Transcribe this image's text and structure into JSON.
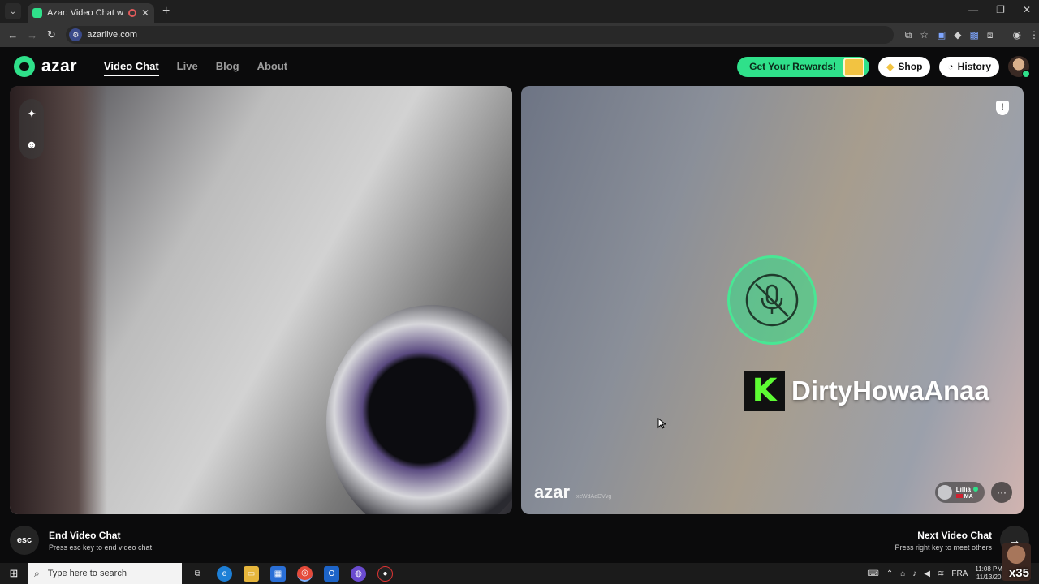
{
  "browser": {
    "tab_title": "Azar: Video Chat with New",
    "new_tab": "+",
    "url": "azarlive.com",
    "window_controls": [
      "—",
      "❐",
      "✕"
    ]
  },
  "header": {
    "logo": "azar",
    "nav": [
      {
        "label": "Video Chat",
        "active": true
      },
      {
        "label": "Live",
        "active": false
      },
      {
        "label": "Blog",
        "active": false
      },
      {
        "label": "About",
        "active": false
      }
    ],
    "rewards_label": "Get Your Rewards!",
    "shop_label": "Shop",
    "history_label": "History"
  },
  "local_video": {
    "tools": [
      "sparkle-icon",
      "sticker-icon"
    ]
  },
  "remote_video": {
    "overlay_name": "DirtyHowaAnaa",
    "overlay_logo_letter": "K",
    "watermark": "azar",
    "watermark_id": "xcWdAaDVvg",
    "partner_name": "Lillia",
    "partner_country": "MA",
    "mute_state": "microphone muted"
  },
  "footer": {
    "end_key": "esc",
    "end_title": "End Video Chat",
    "end_hint": "Press esc key to end video chat",
    "next_title": "Next Video Chat",
    "next_hint": "Press right key to meet others"
  },
  "taskbar": {
    "search_placeholder": "Type here to search",
    "language": "FRA",
    "time": "11:08 PM",
    "date": "11/13/20",
    "overlay_tag": "x35"
  },
  "colors": {
    "accent": "#2fe08a",
    "background": "#0b0b0c"
  }
}
